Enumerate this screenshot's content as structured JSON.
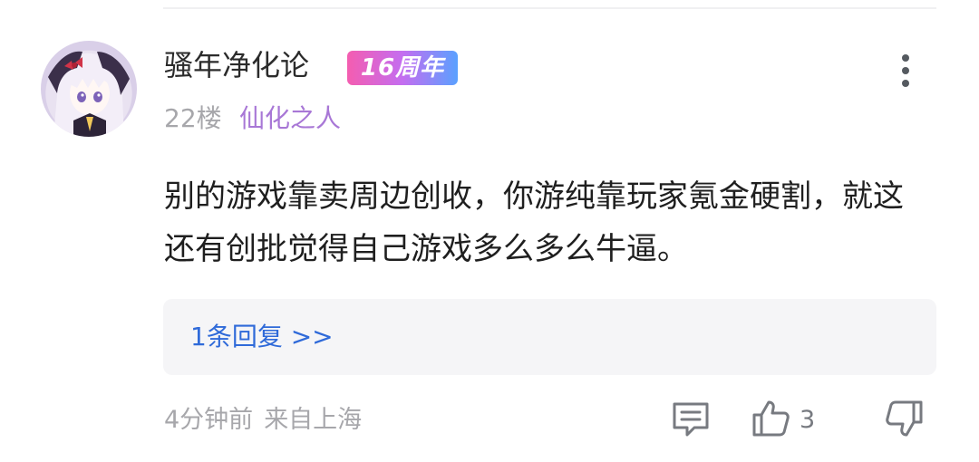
{
  "comment": {
    "username": "骚年净化论",
    "badge": "16周年",
    "floor": "22楼",
    "user_title": "仙化之人",
    "text": "别的游戏靠卖周边创收，你游纯靠玩家氪金硬割，就这还有创批觉得自己游戏多么多么牛逼。",
    "reply_link": "1条回复 >>",
    "time": "4分钟前",
    "location": "来自上海",
    "like_count": "3"
  },
  "icons": {
    "menu": "more-vertical-icon",
    "comment": "comment-icon",
    "like": "thumbs-up-icon",
    "dislike": "thumbs-down-icon"
  },
  "colors": {
    "username": "#2b2b2b",
    "user_title": "#a877d6",
    "reply_link": "#2f6ad9",
    "meta": "#a7a7ab",
    "reply_bg": "#f5f5f7"
  }
}
